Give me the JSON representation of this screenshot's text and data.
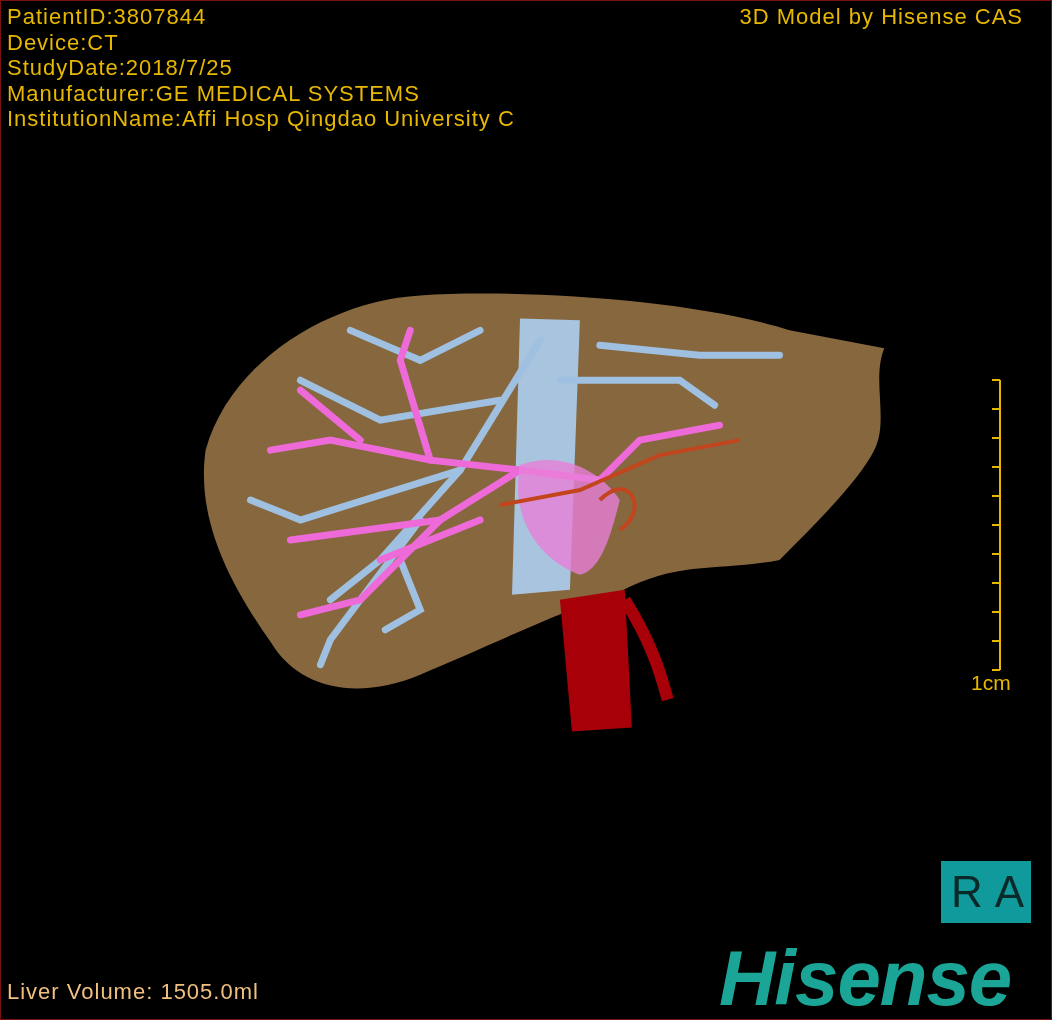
{
  "study_info": [
    "PatientID:3807844",
    "Device:CT",
    "StudyDate:2018/7/25",
    "Manufacturer:GE MEDICAL SYSTEMS",
    "InstitutionName:Affi Hosp Qingdao University C"
  ],
  "model_credit": "3D Model by Hisense CAS",
  "scale": {
    "label": "1cm"
  },
  "orientation": "RA",
  "liver_volume": "Liver Volume: 1505.0ml",
  "logo": "Hisense"
}
